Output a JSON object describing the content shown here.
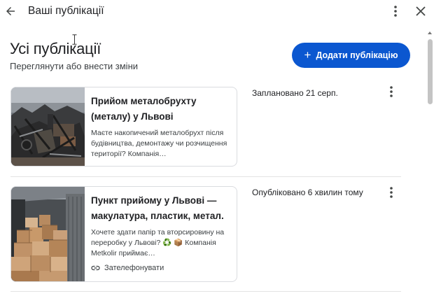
{
  "topbar": {
    "title": "Ваші публікації"
  },
  "header": {
    "heading": "Усі публікації",
    "subheading": "Переглянути або внести зміни",
    "add_button_label": "Додати публікацію"
  },
  "posts": [
    {
      "title": "Прийом металобрухту (металу) у Львові",
      "description": "Маєте накопичений металобрухт після будівництва, демонтажу чи розчищення території? Компанія…",
      "status": "Заплановано 21 серп.",
      "thumbnail": "scrap-metal-photo"
    },
    {
      "title": "Пункт прийому у Львові — макулатура, пластик, метал.",
      "description": "Хочете здати папір та вторсировину на переробку у Львові? ♻️ 📦 Компанія Metkolir приймає…",
      "cta_label": "Зателефонувати",
      "status": "Опубліковано 6 хвилин тому",
      "thumbnail": "cardboard-boxes-photo"
    }
  ],
  "colors": {
    "primary": "#0b57d0",
    "text": "#202124",
    "border": "#dadce0"
  }
}
